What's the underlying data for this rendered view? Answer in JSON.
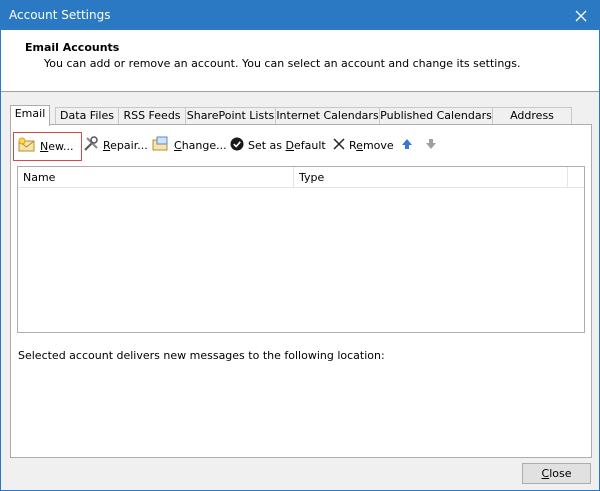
{
  "window": {
    "title": "Account Settings"
  },
  "header": {
    "title": "Email Accounts",
    "subtitle": "You can add or remove an account. You can select an account and change its settings."
  },
  "tabs": [
    {
      "label": "Email",
      "active": true
    },
    {
      "label": "Data Files"
    },
    {
      "label": "RSS Feeds"
    },
    {
      "label": "SharePoint Lists"
    },
    {
      "label": "Internet Calendars"
    },
    {
      "label": "Published Calendars"
    },
    {
      "label": "Address Books"
    }
  ],
  "toolbar": {
    "new_label": "New...",
    "repair_label": "Repair...",
    "change_label": "Change...",
    "set_default_label": "Set as Default",
    "remove_label": "Remove"
  },
  "list": {
    "columns": [
      "Name",
      "Type"
    ]
  },
  "location_text": "Selected account delivers new messages to the following location:",
  "close_label": "Close",
  "colors": {
    "titlebar": "#2b79c2",
    "accent_blue": "#3a78d6",
    "highlight_border": "#d84a4a"
  }
}
